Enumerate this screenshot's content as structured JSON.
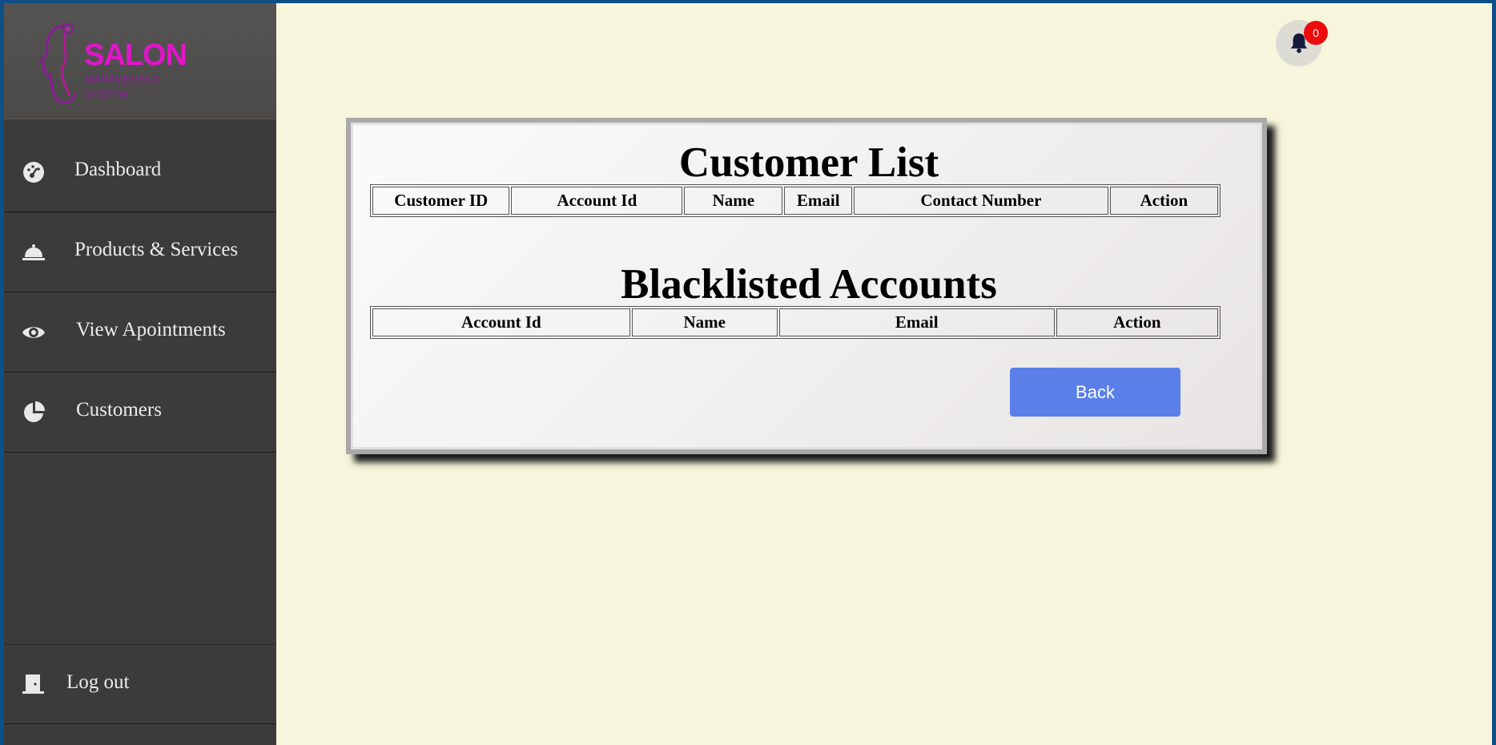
{
  "brand": {
    "main": "SALON",
    "line1": "MANAGEMENT",
    "line2": "SYSTEM"
  },
  "sidebar": {
    "items": [
      {
        "label": "Dashboard",
        "icon": "dashboard-gauge-icon"
      },
      {
        "label": "Products & Services",
        "icon": "service-bell-icon"
      },
      {
        "label": "View Apointments",
        "icon": "eye-icon"
      },
      {
        "label": "Customers",
        "icon": "pie-chart-icon"
      }
    ],
    "logout": {
      "label": "Log out",
      "icon": "door-icon"
    }
  },
  "notifications": {
    "count": "0",
    "icon": "bell-icon"
  },
  "customer_list": {
    "title": "Customer List",
    "columns": [
      "Customer ID",
      "Account Id",
      "Name",
      "Email",
      "Contact Number",
      "Action"
    ]
  },
  "blacklisted": {
    "title": "Blacklisted Accounts",
    "columns": [
      "Account Id",
      "Name",
      "Email",
      "Action"
    ]
  },
  "buttons": {
    "back": "Back"
  },
  "colors": {
    "sidebar": "#3c3b3b",
    "page_bg": "#f7f6dc",
    "brand": "#e015c9",
    "button": "#5a7fe8",
    "badge": "#ee0c0c"
  }
}
